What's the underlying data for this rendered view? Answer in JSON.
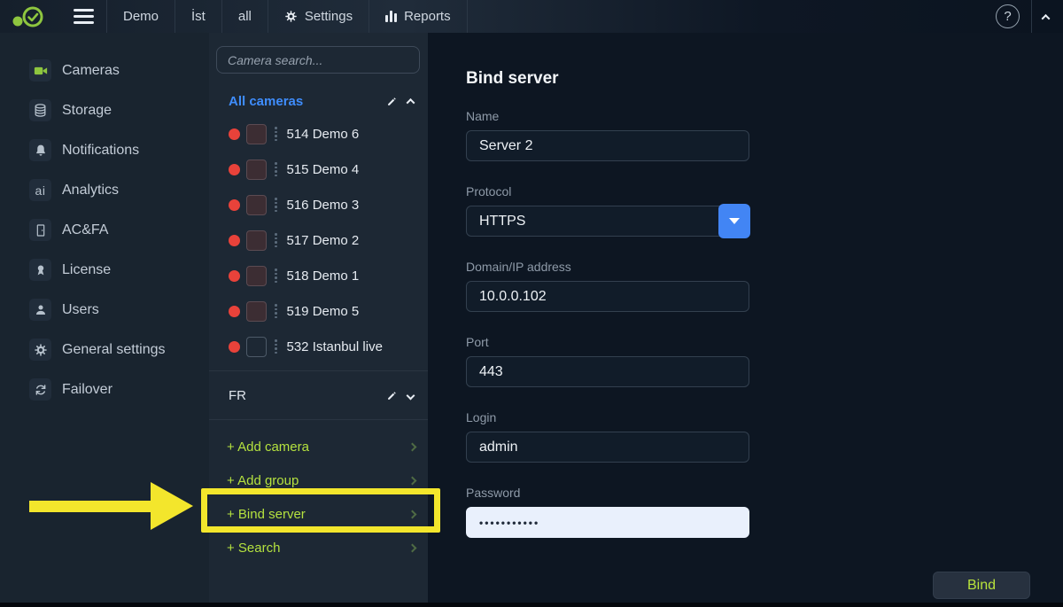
{
  "topbar": {
    "nav": [
      {
        "label": "Demo"
      },
      {
        "label": "İst"
      },
      {
        "label": "all"
      },
      {
        "label": "Settings"
      },
      {
        "label": "Reports"
      }
    ],
    "help": "?"
  },
  "sidebar": {
    "items": [
      {
        "label": "Cameras"
      },
      {
        "label": "Storage"
      },
      {
        "label": "Notifications"
      },
      {
        "label": "Analytics"
      },
      {
        "label": "AC&FA"
      },
      {
        "label": "License"
      },
      {
        "label": "Users"
      },
      {
        "label": "General settings"
      },
      {
        "label": "Failover"
      }
    ]
  },
  "camera_panel": {
    "search_placeholder": "Camera search...",
    "group_all": {
      "name": "All cameras"
    },
    "cameras": [
      {
        "name": "514 Demo 6"
      },
      {
        "name": "515 Demo 4"
      },
      {
        "name": "516 Demo 3"
      },
      {
        "name": "517 Demo 2"
      },
      {
        "name": "518 Demo 1"
      },
      {
        "name": "519 Demo 5"
      },
      {
        "name": "532 Istanbul live"
      }
    ],
    "group_fr": {
      "name": "FR"
    },
    "actions": [
      {
        "label": "+ Add camera"
      },
      {
        "label": "+ Add group"
      },
      {
        "label": "+ Bind server"
      },
      {
        "label": "+ Search"
      }
    ]
  },
  "form": {
    "title": "Bind server",
    "name_label": "Name",
    "name_value": "Server 2",
    "protocol_label": "Protocol",
    "protocol_value": "HTTPS",
    "domain_label": "Domain/IP address",
    "domain_value": "10.0.0.102",
    "port_label": "Port",
    "port_value": "443",
    "login_label": "Login",
    "login_value": "admin",
    "password_label": "Password",
    "password_value": "•••••••••••",
    "submit_label": "Bind"
  },
  "colors": {
    "logo_green": "#8ec63f",
    "action_green": "#b5e23f",
    "highlight_yellow": "#f3e62c",
    "accent_blue": "#4285f4",
    "group_blue": "#3f8dfd",
    "record_red": "#e8423a"
  }
}
